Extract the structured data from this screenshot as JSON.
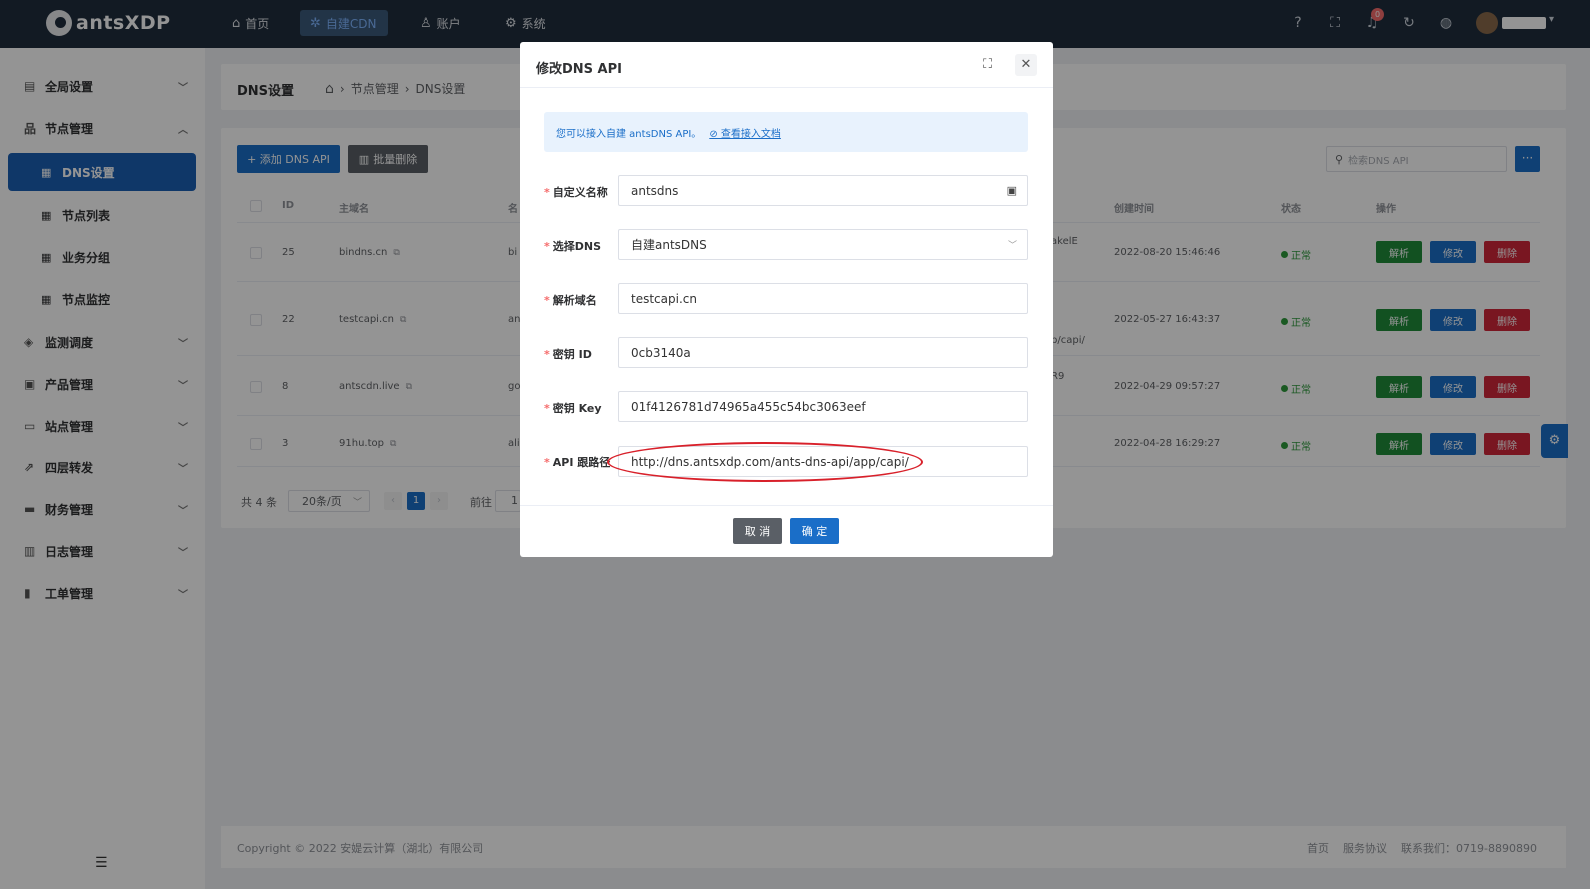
{
  "topbar": {
    "brand": "antsXDP",
    "nav": [
      {
        "label": "首页",
        "icon": "home-icon"
      },
      {
        "label": "自建CDN",
        "icon": "cdn-icon"
      },
      {
        "label": "账户",
        "icon": "user-icon"
      },
      {
        "label": "系统",
        "icon": "gear-icon"
      }
    ],
    "notification_count": "0"
  },
  "sidebar": {
    "items": [
      {
        "label": "全局设置",
        "icon": "settings-icon"
      },
      {
        "label": "节点管理",
        "icon": "node-tree-icon"
      },
      {
        "label": "监测调度",
        "icon": "shield-icon"
      },
      {
        "label": "产品管理",
        "icon": "product-icon"
      },
      {
        "label": "站点管理",
        "icon": "site-icon"
      },
      {
        "label": "四层转发",
        "icon": "forward-icon"
      },
      {
        "label": "财务管理",
        "icon": "finance-icon"
      },
      {
        "label": "日志管理",
        "icon": "log-icon"
      },
      {
        "label": "工单管理",
        "icon": "ticket-icon"
      }
    ],
    "sub_items": [
      {
        "label": "DNS设置"
      },
      {
        "label": "节点列表"
      },
      {
        "label": "业务分组"
      },
      {
        "label": "节点监控"
      }
    ]
  },
  "page": {
    "title": "DNS设置",
    "breadcrumb": [
      "节点管理",
      "DNS设置"
    ],
    "add_button": "+ 添加 DNS API",
    "batch_delete_button": "批量删除",
    "search_placeholder": "检索DNS API",
    "table": {
      "headers": {
        "id": "ID",
        "domain": "主域名",
        "name": "名",
        "created": "创建时间",
        "status": "状态",
        "actions": "操作"
      },
      "rows": [
        {
          "id": "25",
          "domain": "bindns.cn",
          "name": "bi",
          "extra": "akelE",
          "created": "2022-08-20 15:46:46",
          "status": "正常"
        },
        {
          "id": "22",
          "domain": "testcapi.cn",
          "name": "an",
          "extra": "p/capi/",
          "created": "2022-05-27 16:43:37",
          "status": "正常"
        },
        {
          "id": "8",
          "domain": "antscdn.live",
          "name": "go",
          "extra": "R9",
          "created": "2022-04-29 09:57:27",
          "status": "正常"
        },
        {
          "id": "3",
          "domain": "91hu.top",
          "name": "ali",
          "extra": "",
          "created": "2022-04-28 16:29:27",
          "status": "正常"
        }
      ],
      "actions": {
        "parse": "解析",
        "edit": "修改",
        "delete": "删除"
      }
    },
    "pager": {
      "total": "共 4 条",
      "page_size": "20条/页",
      "current": "1",
      "goto_label": "前往",
      "goto_value": "1"
    }
  },
  "footer": {
    "copyright": "Copyright © 2022 安媞云计算（湖北）有限公司",
    "links": [
      "首页",
      "服务协议",
      "联系我们：0719-8890890"
    ]
  },
  "dialog": {
    "title": "修改DNS API",
    "alert_text": "您可以接入自建 antsDNS API。",
    "alert_link": "⊘ 查看接入文档",
    "fields": [
      {
        "label": "自定义名称",
        "value": "antsdns"
      },
      {
        "label": "选择DNS",
        "value": "自建antsDNS"
      },
      {
        "label": "解析域名",
        "value": "testcapi.cn"
      },
      {
        "label": "密钥 ID",
        "value": "0cb3140a"
      },
      {
        "label": "密钥 Key",
        "value": "01f4126781d74965a455c54bc3063eef"
      },
      {
        "label": "API 跟路径",
        "value": "http://dns.antsxdp.com/ants-dns-api/app/capi/"
      }
    ],
    "cancel": "取 消",
    "confirm": "确 定"
  },
  "colors": {
    "topbar": "#1f2d3d",
    "primary": "#1a6ec8",
    "success": "#1f8c3a",
    "danger": "#d1263a",
    "annotation": "#d8202a"
  }
}
